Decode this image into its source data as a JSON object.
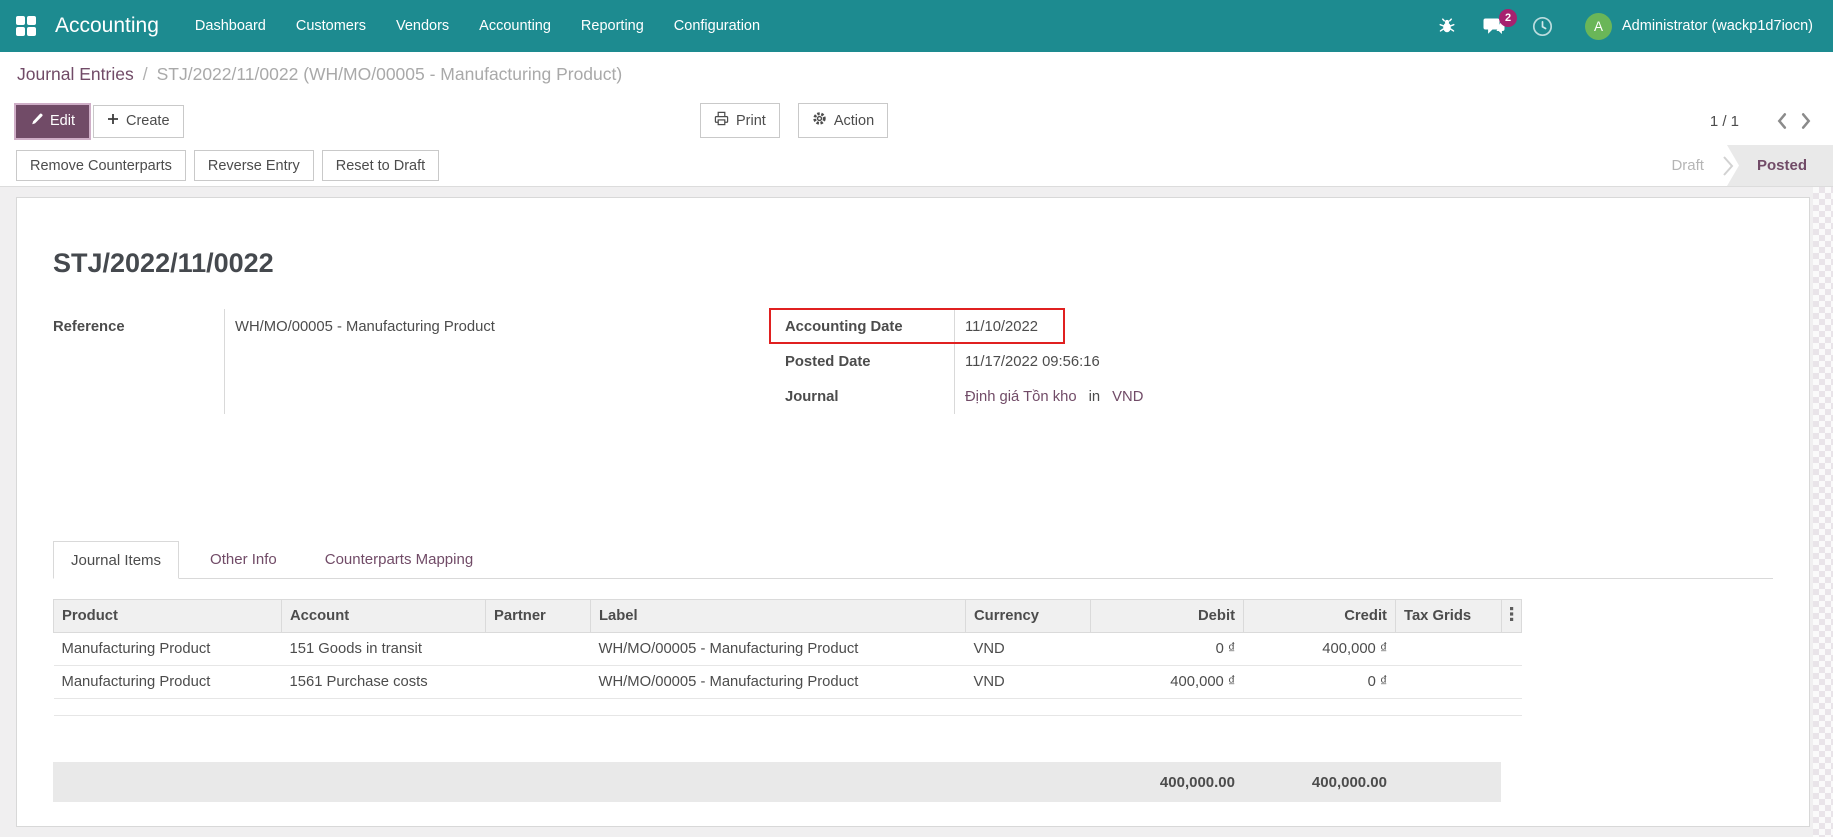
{
  "colors": {
    "navbar-bg": "#1d8b90",
    "primary": "#714b67",
    "badge": "#a7216f",
    "avatar": "#6ab658",
    "highlight": "#e02020",
    "content-bg": "#f0eff0"
  },
  "navbar": {
    "app_name": "Accounting",
    "menu_items": [
      "Dashboard",
      "Customers",
      "Vendors",
      "Accounting",
      "Reporting",
      "Configuration"
    ],
    "message_count": "2",
    "user_initial": "A",
    "user_name": "Administrator (wackp1d7iocn)"
  },
  "breadcrumb": {
    "parent": "Journal Entries",
    "separator": "/",
    "current": "STJ/2022/11/0022 (WH/MO/00005 - Manufacturing Product)"
  },
  "control_panel": {
    "edit_label": "Edit",
    "create_label": "Create",
    "print_label": "Print",
    "action_label": "Action",
    "pager": "1 / 1"
  },
  "statusbar": {
    "buttons": [
      "Remove Counterparts",
      "Reverse Entry",
      "Reset to Draft"
    ],
    "draft_label": "Draft",
    "posted_label": "Posted"
  },
  "sheet": {
    "title": "STJ/2022/11/0022",
    "fields": {
      "reference_label": "Reference",
      "reference_value": "WH/MO/00005 - Manufacturing Product",
      "accounting_date_label": "Accounting Date",
      "accounting_date_value": "11/10/2022",
      "posted_date_label": "Posted Date",
      "posted_date_value": "11/17/2022 09:56:16",
      "journal_label": "Journal",
      "journal_value": "Định giá Tồn kho",
      "journal_in": "in",
      "journal_currency": "VND"
    },
    "tabs": [
      "Journal Items",
      "Other Info",
      "Counterparts Mapping"
    ],
    "table": {
      "columns": [
        "Product",
        "Account",
        "Partner",
        "Label",
        "Currency",
        "Debit",
        "Credit",
        "Tax Grids"
      ],
      "rows": [
        {
          "product": "Manufacturing Product",
          "account": "151 Goods in transit",
          "partner": "",
          "label": "WH/MO/00005 - Manufacturing Product",
          "currency": "VND",
          "debit": "0 ₫",
          "credit": "400,000 ₫",
          "tax_grids": ""
        },
        {
          "product": "Manufacturing Product",
          "account": "1561 Purchase costs",
          "partner": "",
          "label": "WH/MO/00005 - Manufacturing Product",
          "currency": "VND",
          "debit": "400,000 ₫",
          "credit": "0 ₫",
          "tax_grids": ""
        }
      ],
      "totals": {
        "debit": "400,000.00",
        "credit": "400,000.00"
      }
    }
  }
}
